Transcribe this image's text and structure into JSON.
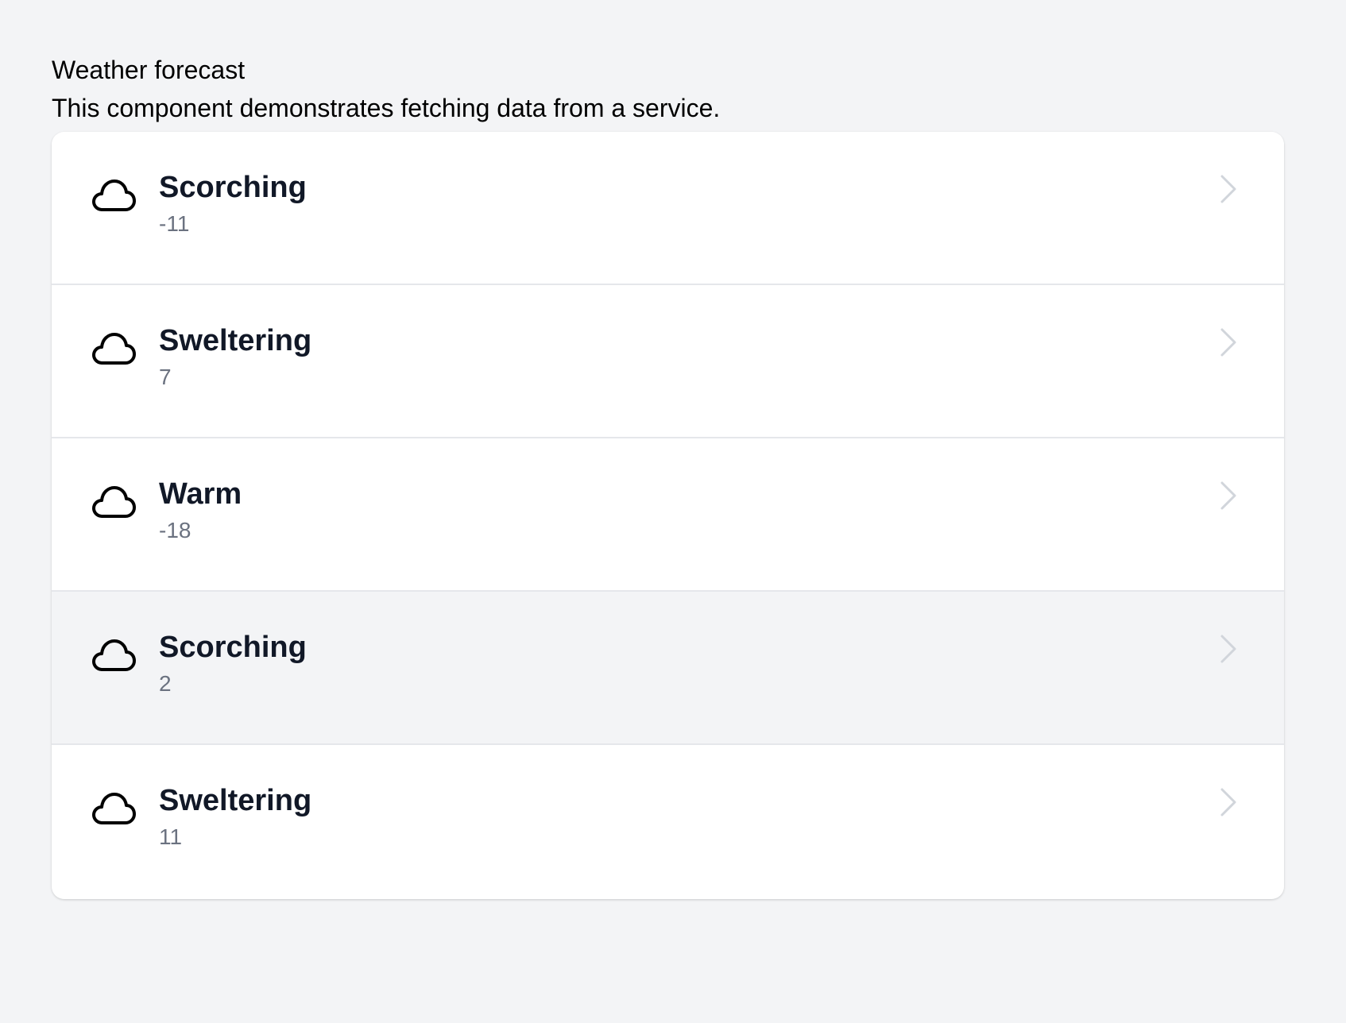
{
  "header": {
    "title": "Weather forecast",
    "description": "This component demonstrates fetching data from a service."
  },
  "forecasts": [
    {
      "summary": "Scorching",
      "temperature": "-11",
      "icon": "cloud-icon"
    },
    {
      "summary": "Sweltering",
      "temperature": "7",
      "icon": "cloud-icon"
    },
    {
      "summary": "Warm",
      "temperature": "-18",
      "icon": "cloud-icon"
    },
    {
      "summary": "Scorching",
      "temperature": "2",
      "icon": "cloud-icon"
    },
    {
      "summary": "Sweltering",
      "temperature": "11",
      "icon": "cloud-icon"
    }
  ],
  "colors": {
    "background": "#f3f4f6",
    "card": "#ffffff",
    "title": "#111827",
    "subtext": "#6b7280",
    "chevron": "#d1d5db"
  }
}
